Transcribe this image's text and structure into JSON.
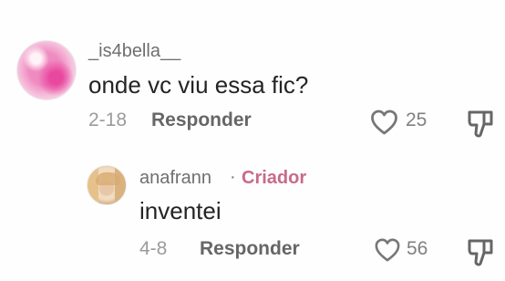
{
  "comments": [
    {
      "username": "_is4bella__",
      "text": "onde vc viu essa fic?",
      "date": "2-18",
      "reply_label": "Responder",
      "likes": "25",
      "avatar_icon": "pink-orb-avatar"
    },
    {
      "username": "anafrann",
      "separator": "·",
      "creator_label": "Criador",
      "text": "inventei",
      "date": "4-8",
      "reply_label": "Responder",
      "likes": "56",
      "avatar_icon": "profile-photo-avatar"
    }
  ],
  "icons": {
    "like": "heart-icon",
    "dislike": "thumbs-down-icon"
  },
  "colors": {
    "creator": "#c86a89",
    "muted_text": "#9b9b9b",
    "body_text": "#242424",
    "icon": "#777777"
  }
}
